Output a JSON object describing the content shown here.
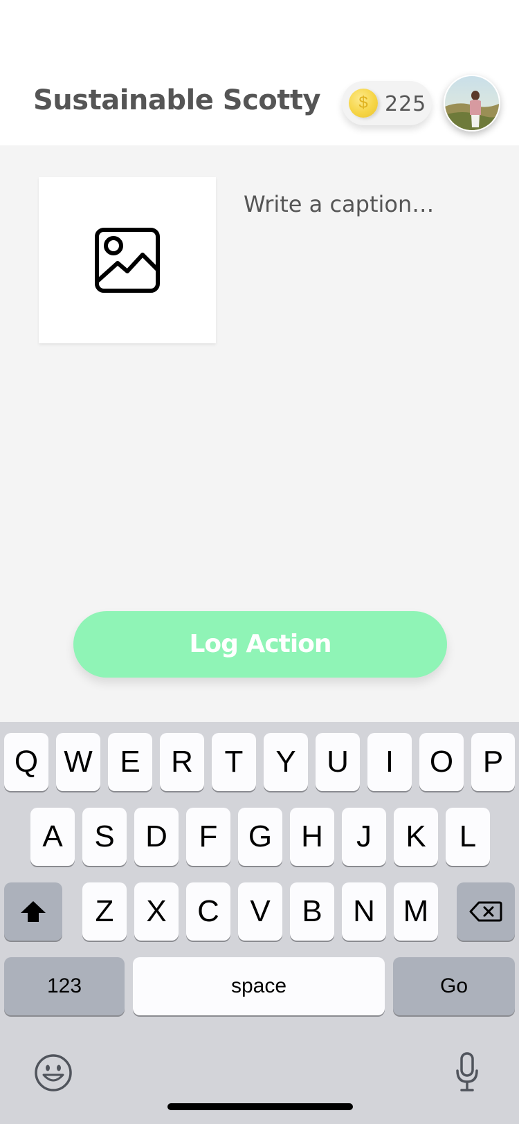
{
  "header": {
    "title": "Sustainable Scotty",
    "coin_symbol": "$",
    "coin_count": "225"
  },
  "composer": {
    "caption_placeholder": "Write a caption…",
    "log_button_label": "Log Action"
  },
  "keyboard": {
    "row1": [
      "Q",
      "W",
      "E",
      "R",
      "T",
      "Y",
      "U",
      "I",
      "O",
      "P"
    ],
    "row2": [
      "A",
      "S",
      "D",
      "F",
      "G",
      "H",
      "J",
      "K",
      "L"
    ],
    "row3": [
      "Z",
      "X",
      "C",
      "V",
      "B",
      "N",
      "M"
    ],
    "numbers_label": "123",
    "space_label": "space",
    "go_label": "Go"
  },
  "colors": {
    "accent_green": "#8ff4b6",
    "coin_gold": "#f6d547",
    "keyboard_bg": "#d3d4d9"
  },
  "icons": {
    "coin": "coin-icon",
    "photo_placeholder": "image-icon",
    "shift": "shift-icon",
    "backspace": "backspace-icon",
    "emoji": "emoji-icon",
    "microphone": "microphone-icon"
  }
}
